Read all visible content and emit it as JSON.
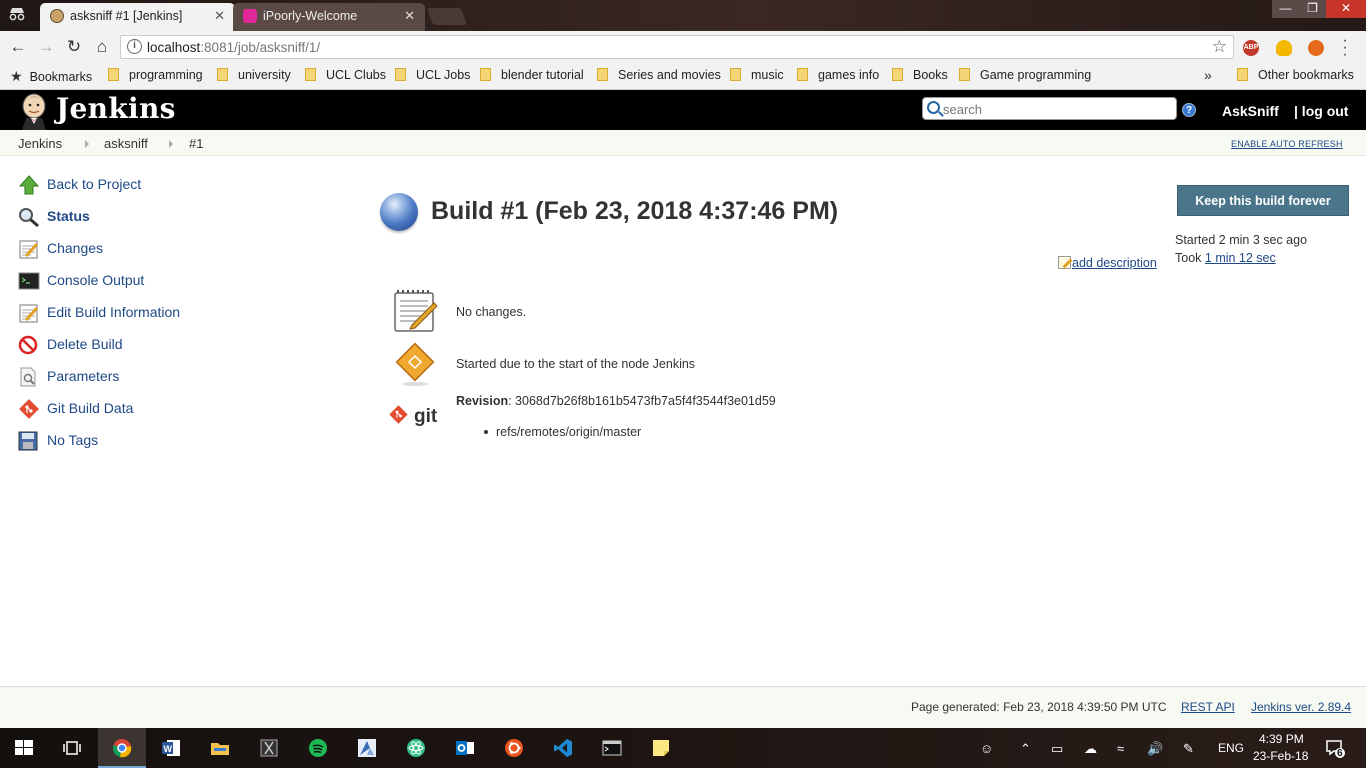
{
  "browser": {
    "tabs": [
      {
        "title": "asksniff #1 [Jenkins]",
        "active": true
      },
      {
        "title": "iPoorly-Welcome",
        "active": false
      }
    ],
    "close_glyph": "✕",
    "url_host": "localhost",
    "url_rest": ":8081/job/asksniff/1/",
    "info_glyph": "i",
    "star_glyph": "☆",
    "extensions": [
      "ABP",
      "idea-bulb-icon",
      "fire-icon"
    ],
    "bookmarks_label": "Bookmarks",
    "bookmark_folders": [
      "programming",
      "university",
      "UCL Clubs",
      "UCL Jobs",
      "blender tutorial",
      "Series and movies",
      "music",
      "games info",
      "Books",
      "Game programming"
    ],
    "more_glyph": "»",
    "other_bookmarks": "Other bookmarks"
  },
  "jenkins": {
    "logo_text": "Jenkins",
    "search_placeholder": "search",
    "help_glyph": "?",
    "user": "AskSniff",
    "logout": "| log out",
    "breadcrumbs": [
      "Jenkins",
      "asksniff",
      "#1"
    ],
    "auto_refresh": "ENABLE AUTO REFRESH"
  },
  "sidebar": {
    "items": [
      {
        "label": "Back to Project",
        "icon": "green-up-arrow-icon",
        "active": false
      },
      {
        "label": "Status",
        "icon": "magnifier-icon",
        "active": true
      },
      {
        "label": "Changes",
        "icon": "notepad-icon",
        "active": false
      },
      {
        "label": "Console Output",
        "icon": "terminal-icon",
        "active": false
      },
      {
        "label": "Edit Build Information",
        "icon": "notepad-edit-icon",
        "active": false
      },
      {
        "label": "Delete Build",
        "icon": "no-entry-icon",
        "active": false
      },
      {
        "label": "Parameters",
        "icon": "document-search-icon",
        "active": false
      },
      {
        "label": "Git Build Data",
        "icon": "git-logo-icon",
        "active": false
      },
      {
        "label": "No Tags",
        "icon": "floppy-disk-icon",
        "active": false
      }
    ]
  },
  "build": {
    "title": "Build #1 (Feb 23, 2018 4:37:46 PM)",
    "status_color": "#4a78c4",
    "keep_button": "Keep this build forever",
    "started": "Started 2 min 3 sec ago",
    "took_prefix": "Took ",
    "took_value": "1 min 12 sec",
    "add_description": "add description",
    "changes_text": "No changes.",
    "cause_text": "Started due to the start of the node Jenkins",
    "revision_label": "Revision",
    "revision_value": ": 3068d7b26f8b161b5473fb7a5f4f3544f3e01d59",
    "git_icon_text": "git",
    "refs": [
      "refs/remotes/origin/master"
    ]
  },
  "footer": {
    "generated": "Page generated: Feb 23, 2018 4:39:50 PM UTC",
    "rest_api": "REST API",
    "version": "Jenkins ver. 2.89.4"
  },
  "taskbar": {
    "apps": [
      "start-windows-icon",
      "task-view-icon",
      "chrome-icon",
      "word-icon",
      "file-explorer-icon",
      "game-app-icon",
      "spotify-icon",
      "azure-app-icon",
      "atom-icon",
      "outlook-icon",
      "ubuntu-icon",
      "vscode-icon",
      "terminal-icon",
      "sticky-notes-icon"
    ],
    "language": "ENG",
    "time": "4:39 PM",
    "date": "23-Feb-18",
    "notification_count": "6"
  },
  "colors": {
    "jenkins_header": "#000000",
    "link": "#204a87",
    "keep_button": "#4b758b",
    "breadcrumb_bg": "#f6faf2"
  }
}
